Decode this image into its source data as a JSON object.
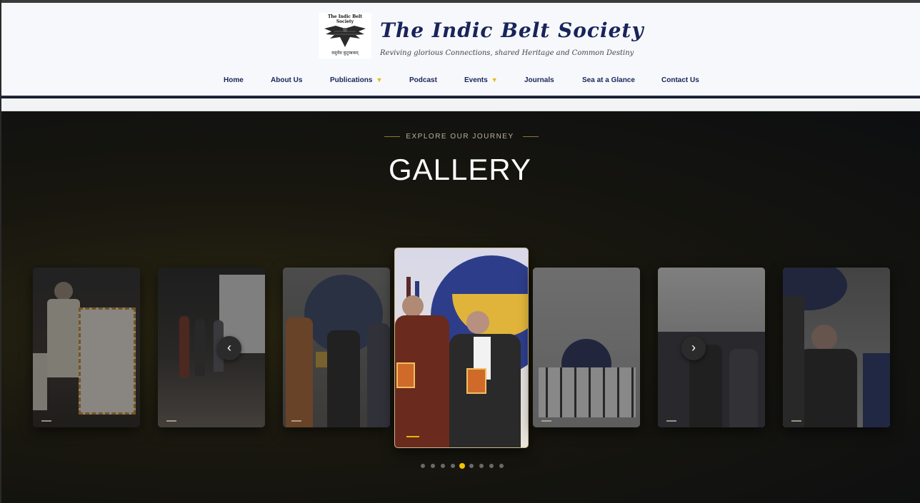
{
  "brand": {
    "logo_caption": "The Indic Belt Society",
    "logo_motto": "वसुधैव कुटुम्बकम्",
    "title": "The Indic Belt Society",
    "tagline": "Reviving glorious Connections, shared Heritage and Common Destiny"
  },
  "nav": {
    "items": [
      {
        "label": "Home"
      },
      {
        "label": "About Us"
      },
      {
        "label": "Publications",
        "has_dropdown": true
      },
      {
        "label": "Podcast"
      },
      {
        "label": "Events",
        "has_dropdown": true
      },
      {
        "label": "Journals"
      },
      {
        "label": "Sea at a Glance"
      },
      {
        "label": "Contact Us"
      }
    ]
  },
  "gallery": {
    "eyebrow": "EXPLORE OUR JOURNEY",
    "title": "GALLERY",
    "prev_glyph": "‹",
    "next_glyph": "›",
    "active_index": 3,
    "total_dots": 9,
    "active_dot": 4,
    "slides": [
      {
        "scene": "speaker-at-podium"
      },
      {
        "scene": "stage-felicitation"
      },
      {
        "scene": "book-presentation"
      },
      {
        "scene": "book-launch-duo"
      },
      {
        "scene": "group-stage-photo"
      },
      {
        "scene": "seated-audience"
      },
      {
        "scene": "press-interaction"
      }
    ]
  },
  "colors": {
    "navy": "#18245a",
    "accent_gold": "#f0c400",
    "hero_bg": "#0d0e10"
  },
  "icons": {
    "prev": "chevron-left-icon",
    "next": "chevron-right-icon",
    "caret": "caret-down-icon"
  }
}
